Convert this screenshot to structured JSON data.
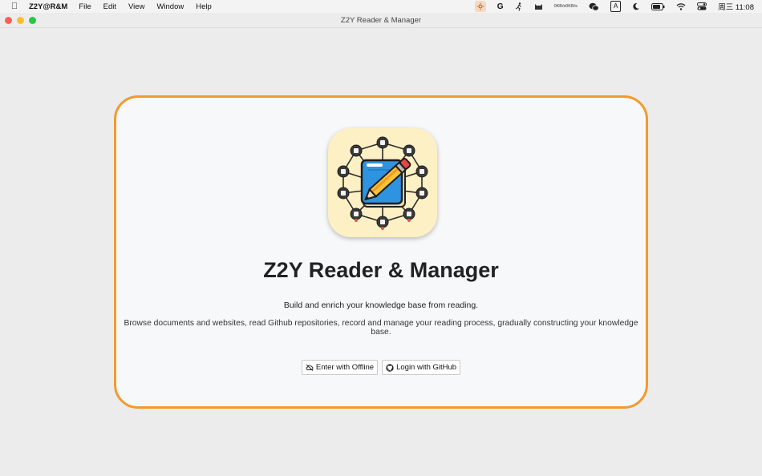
{
  "menubar": {
    "apple_icon": "apple-logo-icon",
    "app_name": "Z2Y@R&M",
    "menus": [
      "File",
      "Edit",
      "View",
      "Window",
      "Help"
    ],
    "status": {
      "net_up": "0KB/s",
      "net_down": "0KB/s",
      "input_method": "A",
      "clock": "周三 11:08"
    }
  },
  "window": {
    "title": "Z2Y Reader & Manager"
  },
  "welcome": {
    "logo_icon": "notebook-pencil-network-icon",
    "title": "Z2Y Reader & Manager",
    "tagline": "Build and enrich your knowledge base from reading.",
    "description": "Browse documents and websites, read Github repositories, record and manage your reading process, gradually constructing your knowledge base.",
    "buttons": {
      "offline": {
        "label": "Enter with Offline",
        "icon": "cloud-off-icon"
      },
      "github": {
        "label": "Login with GitHub",
        "icon": "github-icon"
      }
    }
  },
  "colors": {
    "card_border": "#f29a2e",
    "card_background": "#f7f8fa",
    "window_background": "#ececec"
  }
}
